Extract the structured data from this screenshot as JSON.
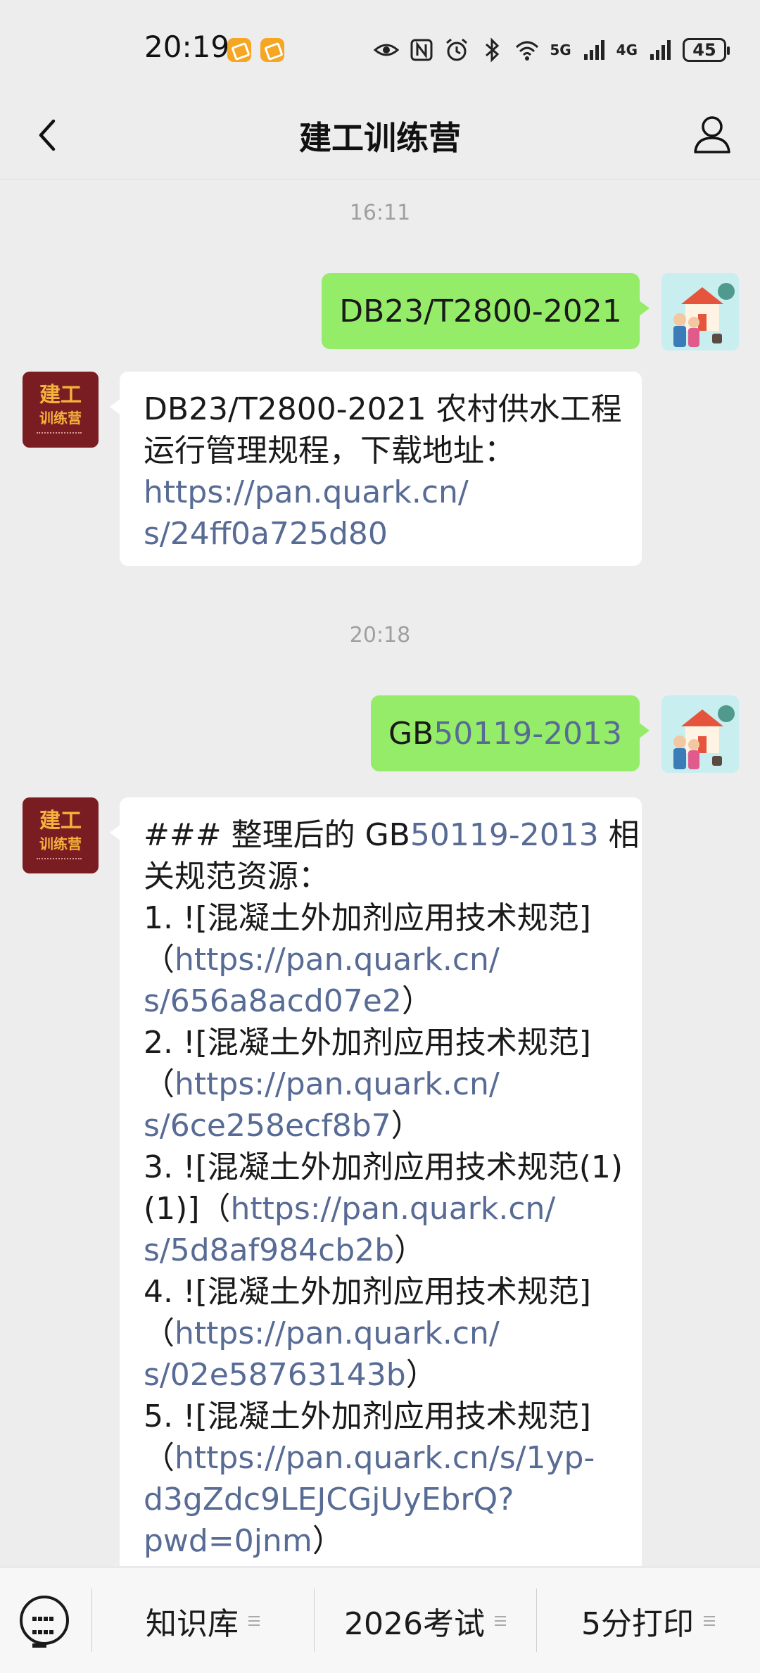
{
  "status_bar": {
    "time": "20:19",
    "signal_1": "5G",
    "signal_2": "4G",
    "battery": "45"
  },
  "header": {
    "title": "建工训练营"
  },
  "bot_avatar": {
    "line1": "建工",
    "line2": "训练营"
  },
  "messages": {
    "ts1": "16:11",
    "me1": "DB23/T2800-2021",
    "bot1": {
      "l1": "DB23/T2800-2021 农村供水工程",
      "l2": "运行管理规程，下载地址：",
      "link_a": "https://pan.quark.cn/",
      "link_b": "s/24ff0a725d80"
    },
    "ts2": "20:18",
    "me2": {
      "prefix": "GB",
      "code": "50119-2013"
    },
    "bot2": {
      "l1_pre": "### 整理后的 GB",
      "l1_code": "50119-2013",
      "l1_post": " 相",
      "l2": "关规范资源：",
      "i1": "1. ![混凝土外加剂应用技术规范]",
      "i1_a": "https://pan.quark.cn/",
      "i1_b": "s/656a8acd07e2",
      "i2": "2. ![混凝土外加剂应用技术规范]",
      "i2_a": "https://pan.quark.cn/",
      "i2_b": "s/6ce258ecf8b7",
      "i3": "3. ![混凝土外加剂应用技术规范(1)",
      "i3_pre": "(1)]（",
      "i3_a": "https://pan.quark.cn/",
      "i3_b": "s/5d8af984cb2b",
      "i4": "4. ![混凝土外加剂应用技术规范]",
      "i4_a": "https://pan.quark.cn/",
      "i4_b": "s/02e58763143b",
      "i5": "5. ![混凝土外加剂应用技术规范]",
      "i5_a": "https://pan.quark.cn/s/1yp-",
      "i5_b": "d3gZdc9LEJCGjUyEbrQ?",
      "i5_c": "pwd=0jnm",
      "open_paren": "（",
      "close_paren": "）"
    }
  },
  "bottom_menu": {
    "item1": "知识库",
    "item2": "2026考试",
    "item3": "5分打印"
  }
}
